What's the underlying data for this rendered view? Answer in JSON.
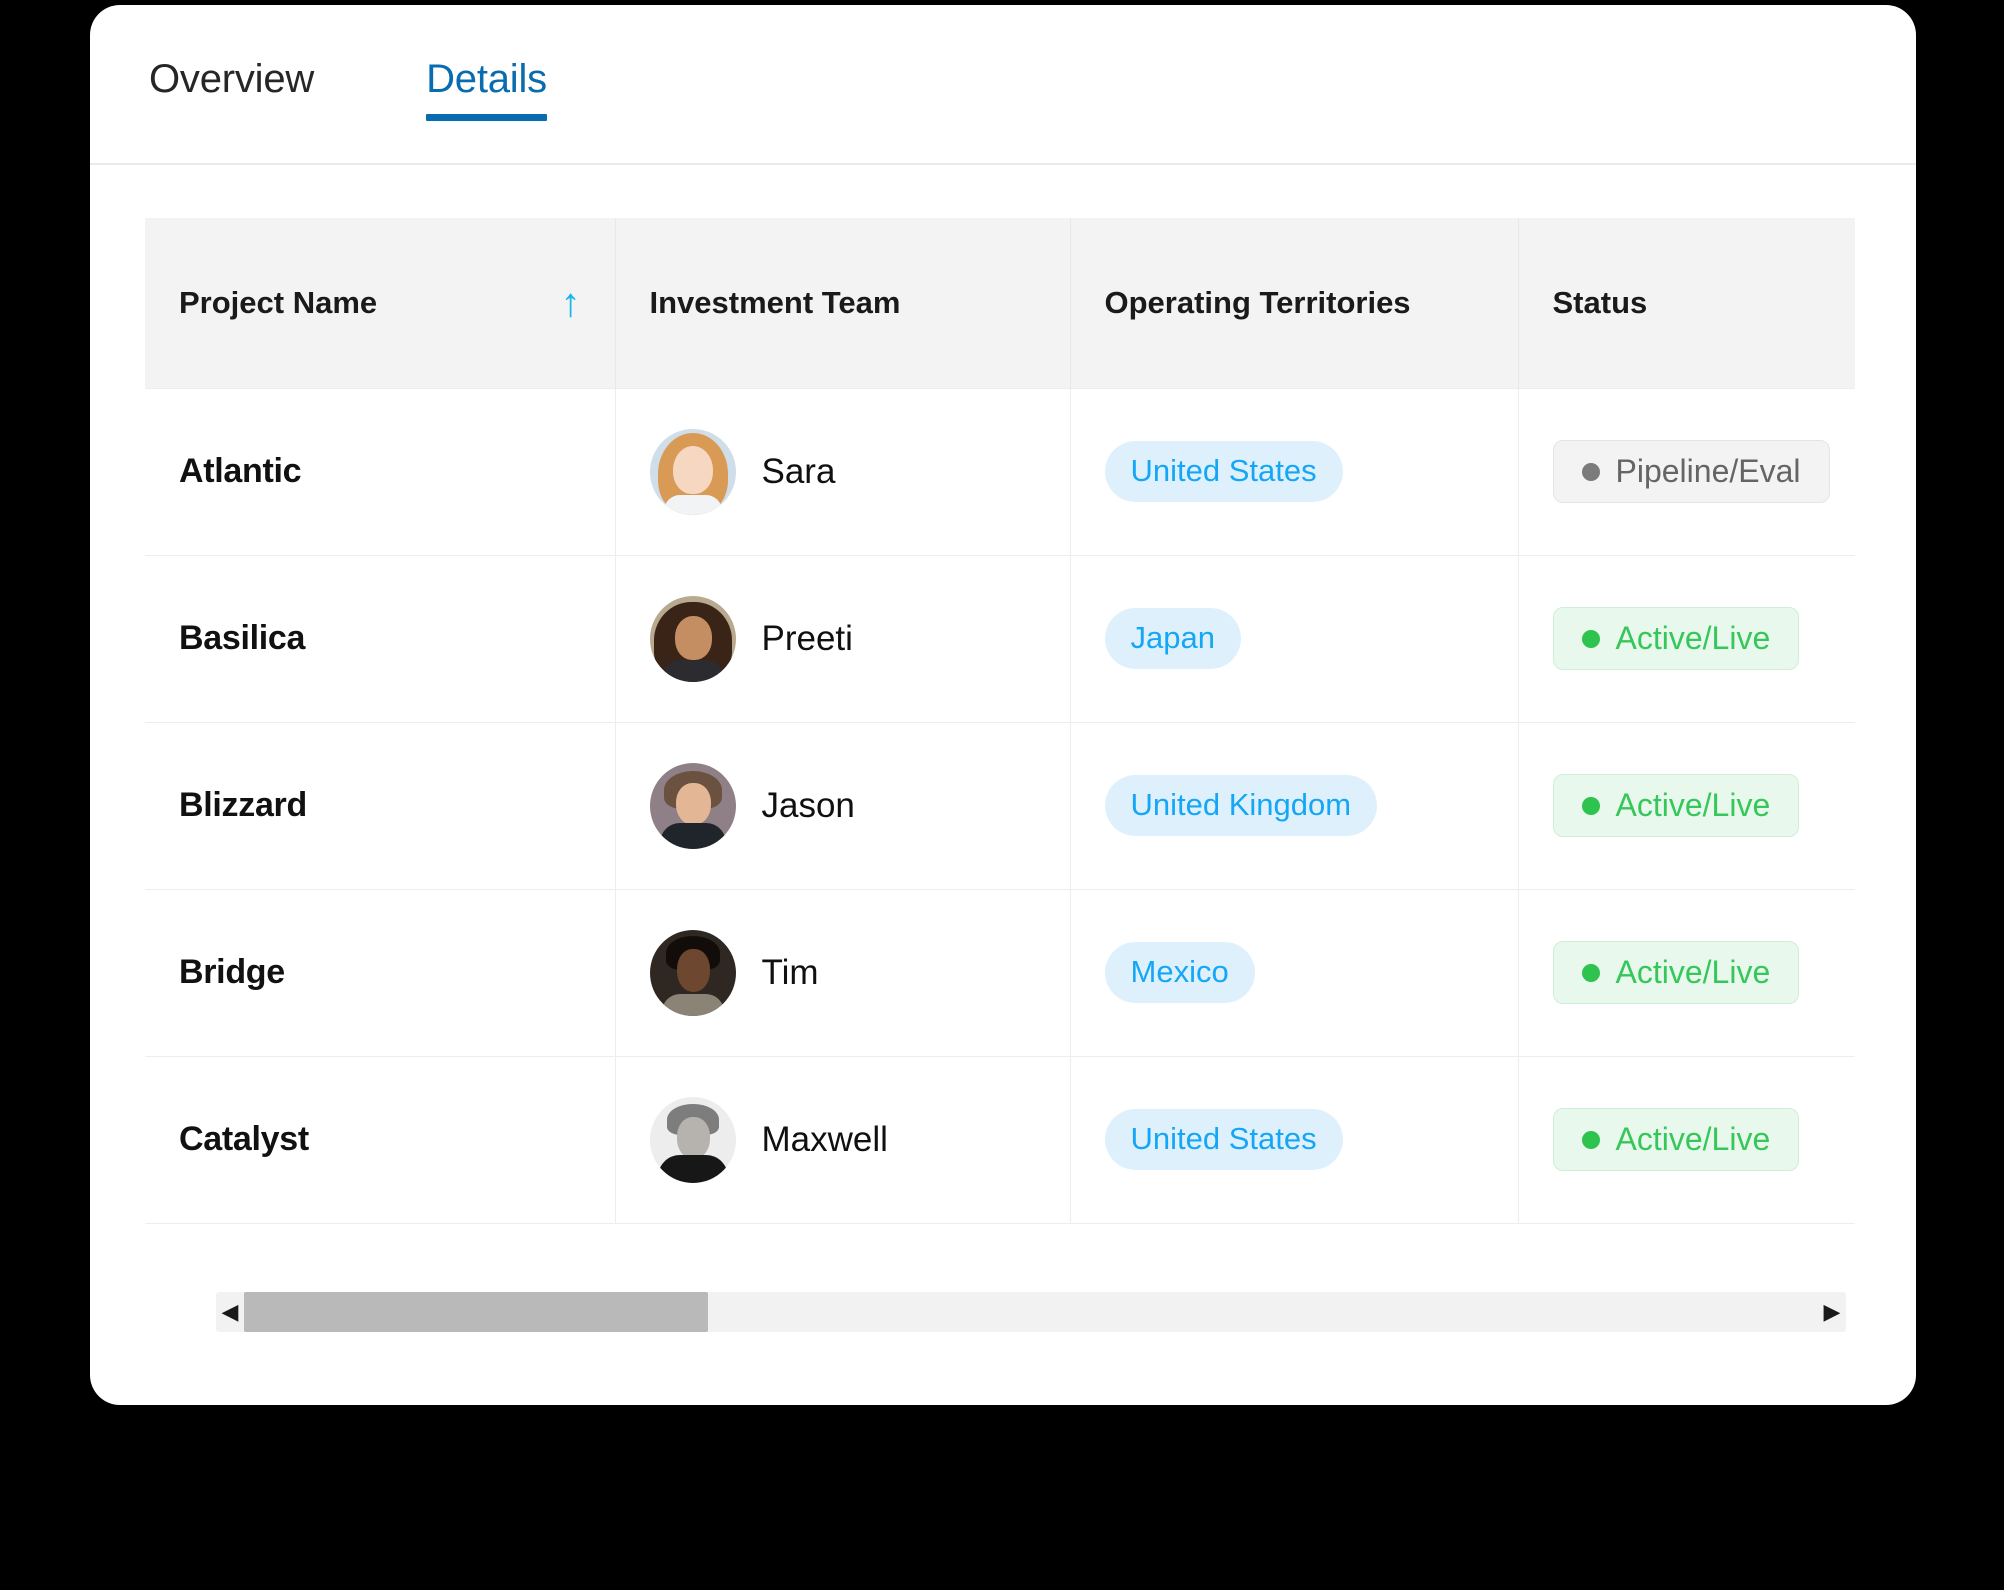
{
  "tabs": [
    {
      "label": "Overview",
      "active": false
    },
    {
      "label": "Details",
      "active": true
    }
  ],
  "table": {
    "columns": [
      {
        "label": "Project Name",
        "sort": "ascending",
        "sort_icon": "arrow-up-icon"
      },
      {
        "label": "Investment Team"
      },
      {
        "label": "Operating Territories"
      },
      {
        "label": "Status"
      }
    ],
    "rows": [
      {
        "project": "Atlantic",
        "member": "Sara",
        "avatar": "avatar-sara",
        "territory": "United States",
        "status": "Pipeline/Eval",
        "status_type": "gray"
      },
      {
        "project": "Basilica",
        "member": "Preeti",
        "avatar": "avatar-preeti",
        "territory": "Japan",
        "status": "Active/Live",
        "status_type": "green"
      },
      {
        "project": "Blizzard",
        "member": "Jason",
        "avatar": "avatar-jason",
        "territory": "United Kingdom",
        "status": "Active/Live",
        "status_type": "green"
      },
      {
        "project": "Bridge",
        "member": "Tim",
        "avatar": "avatar-tim",
        "territory": "Mexico",
        "status": "Active/Live",
        "status_type": "green"
      },
      {
        "project": "Catalyst",
        "member": "Maxwell",
        "avatar": "avatar-maxwell",
        "territory": "United States",
        "status": "Active/Live",
        "status_type": "green"
      }
    ]
  },
  "scrollbar": {
    "left_arrow": "◀",
    "right_arrow": "▶",
    "thumb_position_percent": 0,
    "thumb_width_percent": 29.5
  },
  "colors": {
    "tab_active": "#0a6cb0",
    "sort_icon": "#15b5f0",
    "chip_bg": "#dff0fd",
    "chip_text": "#15a7f5",
    "status_green_text": "#36c75b",
    "status_green_bg": "#e9f8ec",
    "status_gray_text": "#656565",
    "status_gray_bg": "#f3f3f4",
    "header_bg": "#f3f3f4",
    "page_bg": "#000000",
    "card_bg": "#ffffff"
  }
}
